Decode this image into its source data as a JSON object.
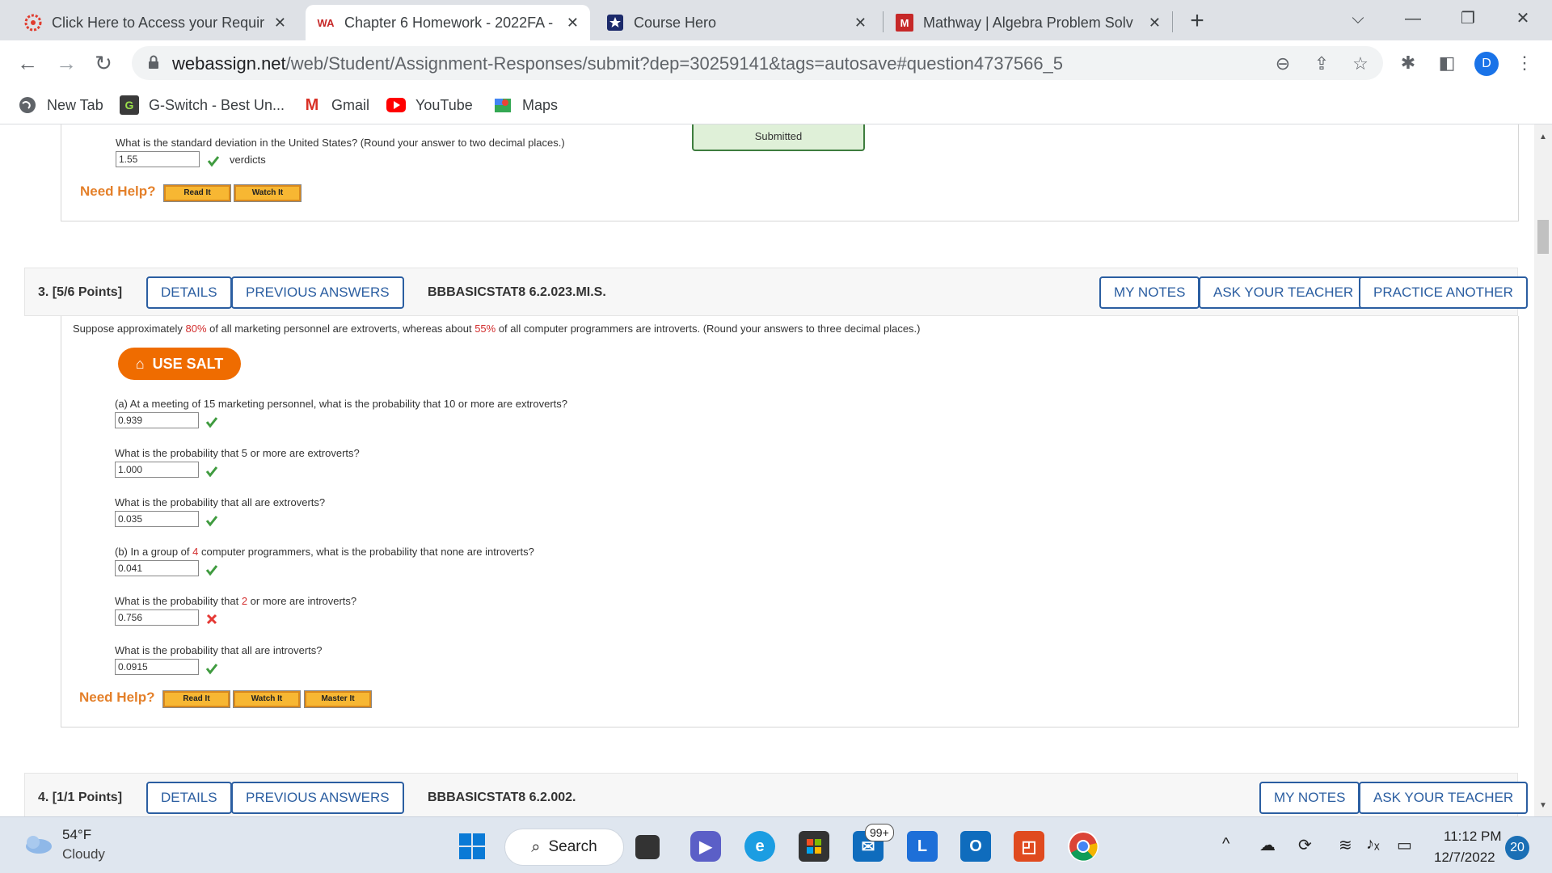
{
  "browser": {
    "tabs": [
      {
        "title": "Click Here to Access your Requir",
        "icon": "canvas-logo-icon"
      },
      {
        "title": "Chapter 6 Homework - 2022FA -",
        "icon": "webassign-logo-icon"
      },
      {
        "title": "Course Hero",
        "icon": "coursehero-logo-icon"
      },
      {
        "title": "Mathway | Algebra Problem Solv",
        "icon": "mathway-logo-icon"
      }
    ],
    "url_domain": "webassign.net",
    "url_path": "/web/Student/Assignment-Responses/submit?dep=30259141&tags=autosave#question4737566_5",
    "profile_initial": "D",
    "bookmarks": [
      {
        "label": "New Tab"
      },
      {
        "label": "G-Switch - Best Un..."
      },
      {
        "label": "Gmail"
      },
      {
        "label": "YouTube"
      },
      {
        "label": "Maps"
      }
    ]
  },
  "colors": {
    "accent_blue": "#2b5ea1",
    "salt_orange": "#ef6c00",
    "help_orange": "#e4802a",
    "correct_green": "#3f9b3f",
    "incorrect_red": "#e53935"
  },
  "prev_question": {
    "submitted_label": "Submitted",
    "question": "What is the standard deviation in the United States? (Round your answer to two decimal places.)",
    "answer": "1.55",
    "unit": "verdicts",
    "status": "correct",
    "need_help": "Need Help?",
    "help_buttons": [
      "Read It",
      "Watch It"
    ]
  },
  "question3": {
    "number": "3.",
    "points": "[5/6 Points]",
    "details_label": "DETAILS",
    "prev_answers_label": "PREVIOUS ANSWERS",
    "code": "BBBASICSTAT8 6.2.023.MI.S.",
    "my_notes_label": "MY NOTES",
    "ask_teacher_label": "ASK YOUR TEACHER",
    "practice_label": "PRACTICE ANOTHER",
    "intro": {
      "part1": "Suppose approximately ",
      "pct1": "80%",
      "part2": " of all marketing personnel are extroverts, whereas about ",
      "pct2": "55%",
      "part3": " of all computer programmers are introverts. (Round your answers to three decimal places.)"
    },
    "salt_label": "USE SALT",
    "parts": {
      "a1": {
        "text": "(a) At a meeting of 15 marketing personnel, what is the probability that 10 or more are extroverts?",
        "answer": "0.939",
        "status": "correct"
      },
      "a2": {
        "text": "What is the probability that 5 or more are extroverts?",
        "answer": "1.000",
        "status": "correct"
      },
      "a3": {
        "text": "What is the probability that all are extroverts?",
        "answer": "0.035",
        "status": "correct"
      },
      "b1": {
        "pre": "(b) In a group of ",
        "num": "4",
        "post": " computer programmers, what is the probability that none are introverts?",
        "answer": "0.041",
        "status": "correct"
      },
      "b2": {
        "pre": "What is the probability that ",
        "num": "2",
        "post": " or more are introverts?",
        "answer": "0.756",
        "status": "incorrect"
      },
      "b3": {
        "text": "What is the probability that all are introverts?",
        "answer": "0.0915",
        "status": "correct"
      }
    },
    "need_help": "Need Help?",
    "help_buttons": [
      "Read It",
      "Watch It",
      "Master It"
    ]
  },
  "question4": {
    "number": "4.",
    "points": "[1/1 Points]",
    "details_label": "DETAILS",
    "prev_answers_label": "PREVIOUS ANSWERS",
    "code": "BBBASICSTAT8 6.2.002.",
    "my_notes_label": "MY NOTES",
    "ask_teacher_label": "ASK YOUR TEACHER"
  },
  "taskbar": {
    "temperature": "54°F",
    "condition": "Cloudy",
    "search_label": "Search",
    "mail_badge": "99+",
    "time": "11:12 PM",
    "date": "12/7/2022",
    "notification_count": "20"
  }
}
